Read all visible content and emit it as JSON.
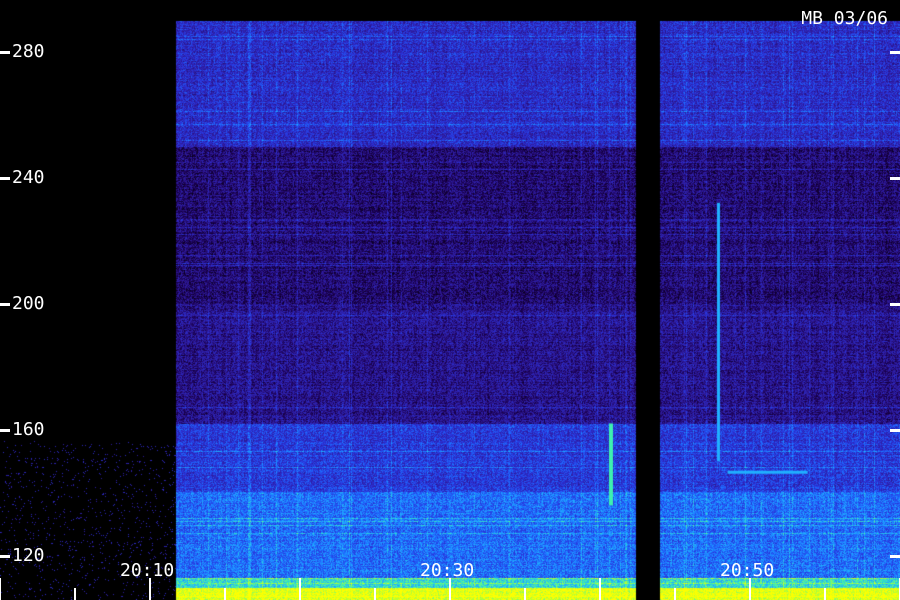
{
  "title": "MB 03/06",
  "chart_data": {
    "type": "heatmap",
    "title": "MB 03/06",
    "y_ticks": [
      120,
      160,
      200,
      240,
      280
    ],
    "y_tick_labels": [
      "120",
      "160",
      "200",
      "240",
      "280"
    ],
    "ylim": [
      106,
      290
    ],
    "x_ticks": [
      "20:10",
      "20:30",
      "20:50"
    ],
    "x_tick_minutes": [
      10,
      30,
      50
    ],
    "xlim_minutes": [
      0,
      60
    ],
    "data_gaps_minutes": [
      [
        0,
        11.7
      ],
      [
        42.4,
        44
      ]
    ],
    "colormap": [
      "#000000",
      "#1a0050",
      "#2e1a9a",
      "#2a32d8",
      "#1e6cff",
      "#20b0ff",
      "#3ef0b0",
      "#b8ff30",
      "#ffff00"
    ],
    "band_intensity": [
      {
        "from": 106,
        "to": 110,
        "level": 0.95
      },
      {
        "from": 110,
        "to": 113,
        "level": 0.7
      },
      {
        "from": 113,
        "to": 140,
        "level": 0.5
      },
      {
        "from": 140,
        "to": 162,
        "level": 0.38
      },
      {
        "from": 162,
        "to": 200,
        "level": 0.22
      },
      {
        "from": 200,
        "to": 250,
        "level": 0.18
      },
      {
        "from": 250,
        "to": 290,
        "level": 0.34
      }
    ]
  }
}
